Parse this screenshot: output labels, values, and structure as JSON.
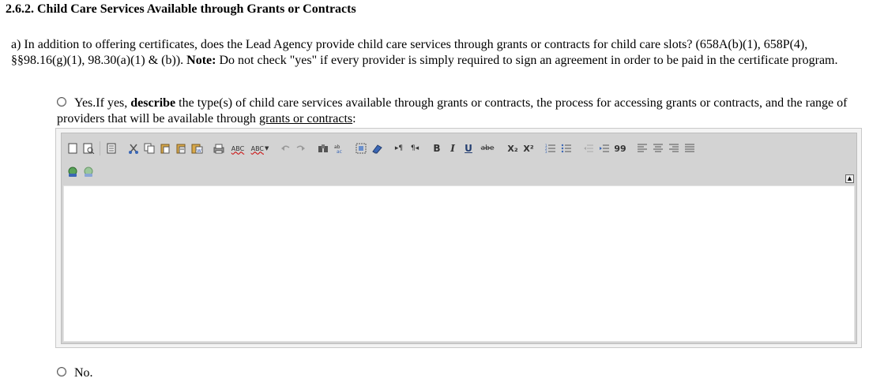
{
  "heading": "2.6.2. Child Care Services Available through Grants or Contracts",
  "question": {
    "lead": "a) In addition to offering certificates, does the Lead Agency provide child care services through grants or contracts for child care slots? (658A(b)(1), 658P(4), §§98.16(g)(1), 98.30(a)(1) & (b)). ",
    "note_label": "Note:",
    "note_text": " Do not check \"yes\" if every provider is simply required to sign an agreement in order to be paid in the certificate program."
  },
  "options": {
    "yes": {
      "prefix": "Yes.If yes, ",
      "emphasis": "describe",
      "middle": " the type(s) of child care services available through grants or contracts, the process for accessing grants or contracts, and the range of providers that will be available through ",
      "link": "grants or contracts",
      "suffix": ":"
    },
    "no": {
      "label": "No."
    }
  },
  "editor": {
    "value": "",
    "toolbar_icons": [
      "new-page",
      "preview",
      "templates",
      "cut",
      "copy",
      "paste",
      "paste-text",
      "paste-word",
      "print",
      "spellcheck",
      "spellcheck-dropdown",
      "undo",
      "redo",
      "find",
      "replace",
      "select-all",
      "remove-format",
      "ltr",
      "rtl",
      "bold",
      "italic",
      "underline",
      "strikethrough",
      "subscript",
      "superscript",
      "numbered-list",
      "bulleted-list",
      "outdent",
      "indent",
      "blockquote",
      "align-left",
      "align-center",
      "align-right",
      "justify",
      "link",
      "unlink"
    ],
    "text_buttons": {
      "spell": "ABC",
      "spell2": "ABC",
      "bold": "B",
      "italic": "I",
      "underline": "U",
      "strike": "abe",
      "sub": "X₂",
      "sup": "X²",
      "quote": "99",
      "ltr": "▸¶",
      "rtl": "¶◂",
      "collapse": "▲"
    }
  }
}
